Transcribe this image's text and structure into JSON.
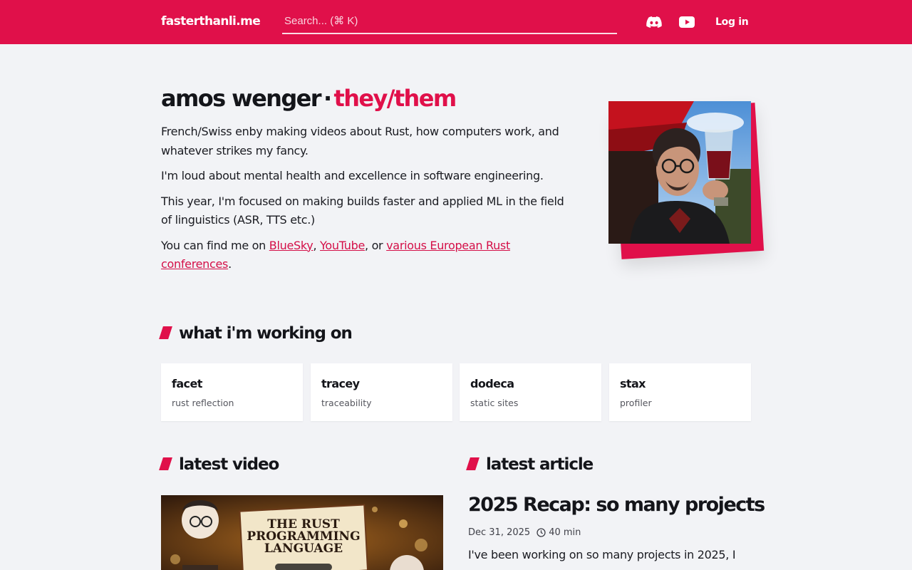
{
  "header": {
    "logo": "fasterthanli.me",
    "search_placeholder": "Search... (⌘ K)",
    "icons": [
      "discord-icon",
      "youtube-icon"
    ],
    "login_label": "Log in",
    "brand_color": "#e0104a"
  },
  "intro": {
    "name": "amos wenger",
    "separator": "·",
    "pronouns": "they/them",
    "paragraph1": "French/Swiss enby making videos about Rust, how computers work, and whatever strikes my fancy.",
    "paragraph2": "I'm loud about mental health and excellence in software engineering.",
    "paragraph3": "This year, I'm focused on making builds faster and applied ML in the field of linguistics (ASR, TTS etc.)",
    "find_me_prefix": "You can find me on",
    "link_bluesky": "BlueSky",
    "comma": ",",
    "link_youtube": "YouTube",
    "or_text": ", or",
    "link_conferences": "various European Rust conferences",
    "period": "."
  },
  "working_on": {
    "heading": "what i'm working on",
    "projects": [
      {
        "title": "facet",
        "subtitle": "rust reflection"
      },
      {
        "title": "tracey",
        "subtitle": "traceability"
      },
      {
        "title": "dodeca",
        "subtitle": "static sites"
      },
      {
        "title": "stax",
        "subtitle": "profiler"
      }
    ]
  },
  "latest_video": {
    "heading": "latest video",
    "thumbnail_text": [
      "THE RUST",
      "PROGRAMMING",
      "LANGUAGE"
    ]
  },
  "latest_article": {
    "heading": "latest article",
    "title": "2025 Recap: so many projects",
    "date": "Dec 31, 2025",
    "read_time": "40 min",
    "excerpt": "I've been working on so many projects in 2025, I"
  }
}
